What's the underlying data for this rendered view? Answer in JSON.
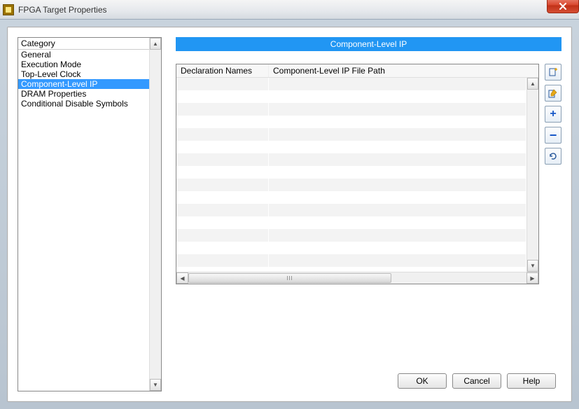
{
  "window": {
    "title": "FPGA Target Properties"
  },
  "category": {
    "header": "Category",
    "items": [
      "General",
      "Execution Mode",
      "Top-Level Clock",
      "Component-Level IP",
      "DRAM Properties",
      "Conditional Disable Symbols"
    ],
    "selected_index": 3
  },
  "banner": {
    "title": "Component-Level IP"
  },
  "table": {
    "columns": [
      "Declaration Names",
      "Component-Level IP File Path"
    ],
    "rows": []
  },
  "toolbar_icons": {
    "new": "new-file-icon",
    "edit": "edit-icon",
    "add": "plus-icon",
    "remove": "minus-icon",
    "refresh": "refresh-icon"
  },
  "buttons": {
    "ok": "OK",
    "cancel": "Cancel",
    "help": "Help"
  }
}
